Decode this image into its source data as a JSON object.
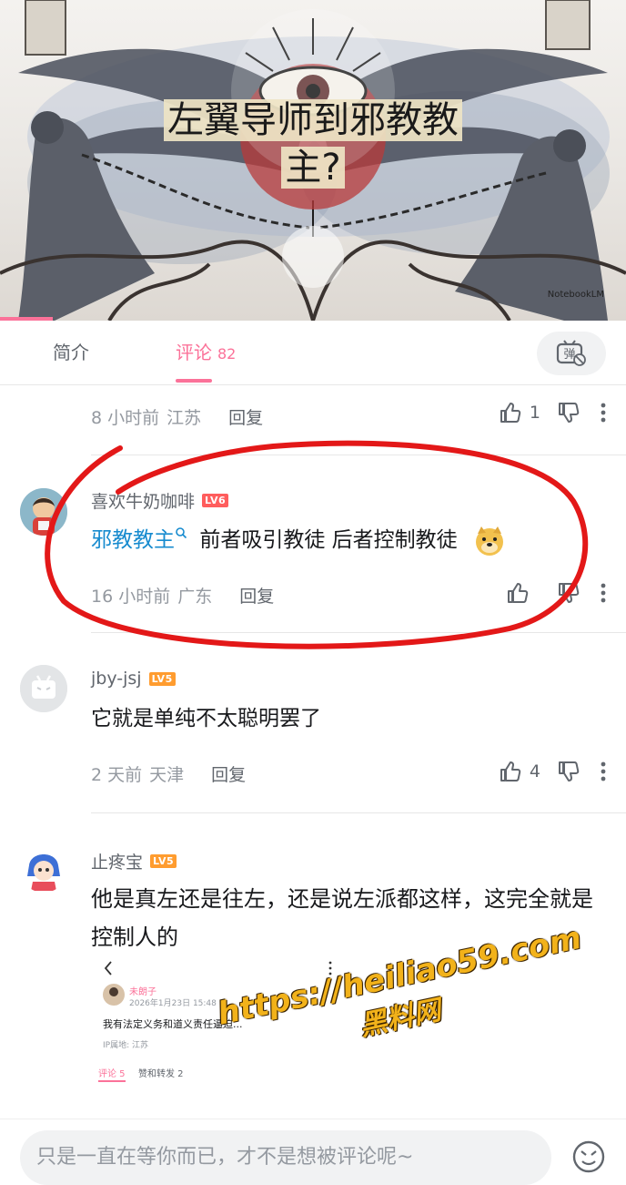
{
  "video": {
    "title_line1": "左翼导师到邪教教",
    "title_line2": "主?",
    "watermark": "NotebookLM",
    "progress": 0.084
  },
  "tabs": [
    {
      "label": "简介"
    },
    {
      "label": "评论",
      "count": "82"
    }
  ],
  "accent_color": "#fb7299",
  "comments": [
    {
      "time": "8 小时前",
      "location": "江苏",
      "reply_label": "回复",
      "likes": "1"
    },
    {
      "username": "喜欢牛奶咖啡",
      "level": "LV6",
      "hashtag": "邪教教主",
      "text": "前者吸引教徒 后者控制教徒",
      "emoji": "doge",
      "time": "16 小时前",
      "location": "广东",
      "reply_label": "回复",
      "likes": ""
    },
    {
      "username": "jby-jsj",
      "level": "LV5",
      "text": "它就是单纯不太聪明罢了",
      "time": "2 天前",
      "location": "天津",
      "reply_label": "回复",
      "likes": "4"
    },
    {
      "username": "止疼宝",
      "level": "LV5",
      "text": "他是真左还是往左，还是说左派都这样，这完全就是控制人的",
      "embedded_screenshot": {
        "name": "未朗子",
        "date": "2026年1月23日 15:48",
        "text": "我有法定义务和道义责任逼迫...",
        "ip": "IP属地: 江苏",
        "tab1": "评论 5",
        "tab2": "赞和转发 2"
      }
    }
  ],
  "overlay_watermark": {
    "url": "https://heiliao59.com",
    "name": "黑料网"
  },
  "input": {
    "placeholder": "只是一直在等你而已，才不是想被评论呢~"
  }
}
